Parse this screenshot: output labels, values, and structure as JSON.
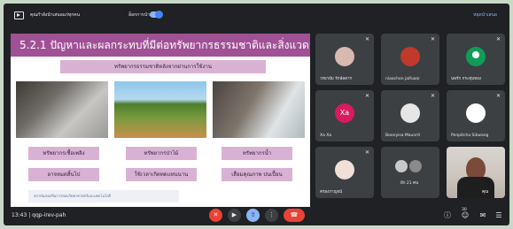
{
  "topbar": {
    "presenting_label": "คุณกำลังนำเสนอแก่ทุกคน",
    "lock_label": "ล็อกการนำเสนอ",
    "stop_label": "หยุดนำเสนอ"
  },
  "slide": {
    "title": "5.2.1 ปัญหาและผลกระทบที่มีต่อทรัพยากรธรรมชาติและสิ่งแวดล้อม",
    "subtitle": "ทรัพยากรธรรมชาติหลังจากผ่านการใช้งาน",
    "resources": [
      {
        "label": "ทรัพยากรเชื้อเพลิง",
        "effect": "อาจหมดสิ้นไป"
      },
      {
        "label": "ทรัพยากรป่าไม้",
        "effect": "ใช้เวลาเกิดทดแทนนาน"
      },
      {
        "label": "ทรัพยากรน้ำ",
        "effect": "เสื่อมคุณภาพ ปนเปื้อน"
      }
    ],
    "footer": "สถาบันส่งเสริมการสอนวิทยาศาสตร์และเทคโนโลยี"
  },
  "participants": [
    {
      "name": "วรยาอ้ม รักษ์ลดาร",
      "avatar": "photo",
      "color": "#d8b9b0"
    },
    {
      "name": "niaachon jaifuaai",
      "avatar": "photo",
      "color": "#c0392b"
    },
    {
      "name": "นพรัก กระทุ่มทอง",
      "avatar": "person-icon",
      "color": "#0f9d58"
    },
    {
      "name": "Xa Xa",
      "avatar": "Xa",
      "color": "#d81b60"
    },
    {
      "name": "Boonyisa Maunrit",
      "avatar": "photo",
      "color": "#e6e6e6"
    },
    {
      "name": "Penpitcha Sikwang",
      "avatar": "photo",
      "color": "#ffffff"
    },
    {
      "name": "ครองกาญจน์",
      "avatar": "photo",
      "color": "#f0e0d8"
    },
    {
      "name": "อีก 21 คน",
      "avatar": "group",
      "color": "#5f6368"
    },
    {
      "name": "คุณ",
      "avatar": "video",
      "color": "#cfc8c1"
    }
  ],
  "bottombar": {
    "time": "13:43",
    "separator": "|",
    "meeting_code": "qqp-irev-pah",
    "participant_count": "30"
  },
  "icons": {
    "mic_off": "mic-off-icon",
    "camera": "camera-icon",
    "present": "present-icon",
    "more": "more-icon",
    "hangup": "hangup-icon",
    "info": "info-icon",
    "people": "people-icon",
    "chat": "chat-icon",
    "activities": "activities-icon"
  }
}
